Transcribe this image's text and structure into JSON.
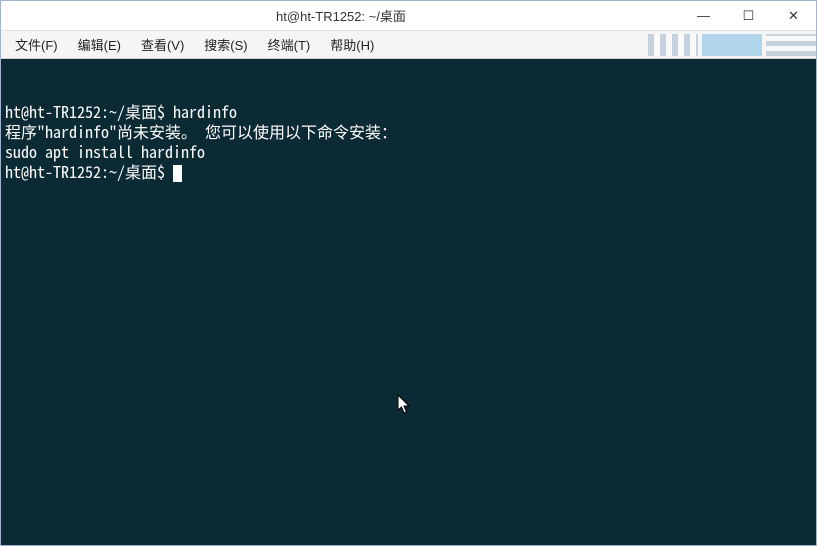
{
  "window": {
    "title": "ht@ht-TR1252: ~/桌面",
    "controls": {
      "minimize": "—",
      "maximize": "☐",
      "close": "✕"
    }
  },
  "menubar": {
    "file": "文件(F)",
    "edit": "编辑(E)",
    "view": "查看(V)",
    "search": "搜索(S)",
    "terminal": "终端(T)",
    "help": "帮助(H)"
  },
  "terminal": {
    "line1_prompt": "ht@ht-TR1252:~/桌面$ ",
    "line1_cmd": "hardinfo",
    "line2": "程序\"hardinfo\"尚未安装。 您可以使用以下命令安装：",
    "line3": "sudo apt install hardinfo",
    "line4_prompt": "ht@ht-TR1252:~/桌面$ "
  }
}
